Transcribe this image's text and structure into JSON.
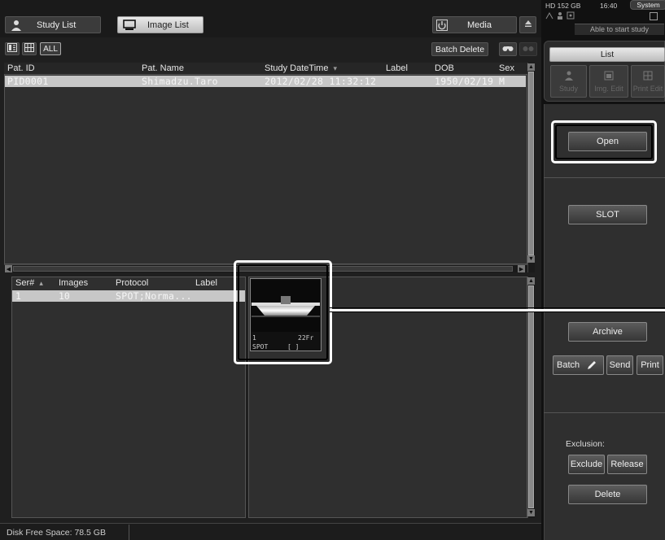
{
  "top_bar": {
    "study_list_label": "Study List",
    "image_list_label": "Image List",
    "media_label": "Media"
  },
  "status": {
    "disk": "HD 152 GB",
    "time": "16:40",
    "system_label": "System",
    "start_status": "Able to start study"
  },
  "toolbar": {
    "all_label": "ALL",
    "batch_delete_label": "Batch Delete"
  },
  "study_table": {
    "headers": [
      "Pat. ID",
      "Pat. Name",
      "Study DateTime",
      "Label",
      "DOB",
      "Sex"
    ],
    "sort_indicator": "▾",
    "rows": [
      {
        "pat_id": "PID0001",
        "pat_name": "Shimadzu.Taro",
        "study_datetime": "2012/02/28 11:32:12",
        "label": "",
        "dob": "1950/02/19",
        "sex": "M"
      }
    ]
  },
  "series_table": {
    "headers": [
      "Ser#",
      "Images",
      "Protocol",
      "Label"
    ],
    "sort_indicator": "▴",
    "rows": [
      {
        "ser": "1",
        "images": "10",
        "protocol": "SPOT;Norma...",
        "label": ""
      }
    ]
  },
  "thumbnail": {
    "index": "1",
    "frames": "22Fr",
    "protocol": "SPOT",
    "bracket": "[ ]"
  },
  "right_panel": {
    "list_tab": "List",
    "study_label": "Study",
    "img_edit_label": "Img. Edit",
    "print_edit_label": "Print Edit",
    "open_label": "Open",
    "slot_label": "SLOT",
    "archive_label": "Archive",
    "batch_label": "Batch",
    "send_label": "Send",
    "print_label": "Print",
    "exclusion_label": "Exclusion:",
    "exclude_label": "Exclude",
    "release_label": "Release",
    "delete_label": "Delete"
  },
  "footer": {
    "disk_free": "Disk Free Space: 78.5 GB"
  },
  "colors": {
    "selected_row": "#c9c9c9",
    "selected_text": "#f2f2f2",
    "panel_bg": "#2f2f2f",
    "highlight": "#ffffff"
  }
}
